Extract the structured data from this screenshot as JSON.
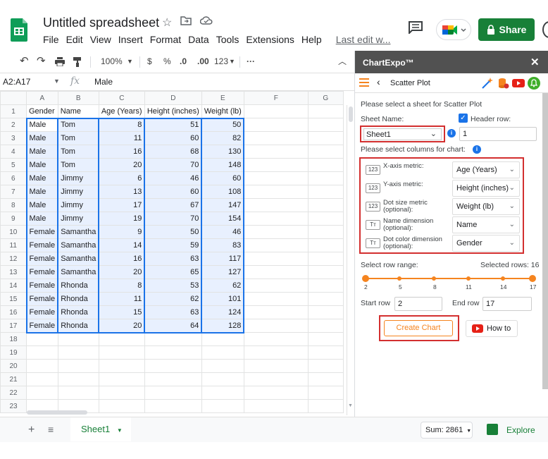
{
  "app": {
    "doc_title": "Untitled spreadsheet",
    "menu": [
      "File",
      "Edit",
      "View",
      "Insert",
      "Format",
      "Data",
      "Tools",
      "Extensions",
      "Help"
    ],
    "last_edit": "Last edit w...",
    "share_label": "Share"
  },
  "toolbar": {
    "zoom": "100%",
    "currency": "$",
    "percent": "%",
    "dec_less": ".0",
    "dec_more": ".00",
    "format": "123"
  },
  "formula_bar": {
    "name_box": "A2:A17",
    "fx": "fx",
    "value": "Male"
  },
  "sheet": {
    "columns": [
      "A",
      "B",
      "C",
      "D",
      "E",
      "F",
      "G"
    ],
    "rows": [
      [
        "Gender",
        "Name",
        "Age (Years)",
        "Height (inches)",
        "Weight (lb)"
      ],
      [
        "Male",
        "Tom",
        "8",
        "51",
        "50"
      ],
      [
        "Male",
        "Tom",
        "11",
        "60",
        "82"
      ],
      [
        "Male",
        "Tom",
        "16",
        "68",
        "130"
      ],
      [
        "Male",
        "Tom",
        "20",
        "70",
        "148"
      ],
      [
        "Male",
        "Jimmy",
        "6",
        "46",
        "60"
      ],
      [
        "Male",
        "Jimmy",
        "13",
        "60",
        "108"
      ],
      [
        "Male",
        "Jimmy",
        "17",
        "67",
        "147"
      ],
      [
        "Male",
        "Jimmy",
        "19",
        "70",
        "154"
      ],
      [
        "Female",
        "Samantha",
        "9",
        "50",
        "46"
      ],
      [
        "Female",
        "Samantha",
        "14",
        "59",
        "83"
      ],
      [
        "Female",
        "Samantha",
        "16",
        "63",
        "117"
      ],
      [
        "Female",
        "Samantha",
        "20",
        "65",
        "127"
      ],
      [
        "Female",
        "Rhonda",
        "8",
        "53",
        "62"
      ],
      [
        "Female",
        "Rhonda",
        "11",
        "62",
        "101"
      ],
      [
        "Female",
        "Rhonda",
        "15",
        "63",
        "124"
      ],
      [
        "Female",
        "Rhonda",
        "20",
        "64",
        "128"
      ],
      [
        "",
        "",
        "",
        "",
        ""
      ],
      [
        "",
        "",
        "",
        "",
        ""
      ],
      [
        "",
        "",
        "",
        "",
        ""
      ],
      [
        "",
        "",
        "",
        "",
        ""
      ],
      [
        "",
        "",
        "",
        "",
        ""
      ],
      [
        "",
        "",
        "",
        "",
        ""
      ]
    ]
  },
  "bottom": {
    "sheet_tab": "Sheet1",
    "sum": "Sum: 2861",
    "explore": "Explore"
  },
  "panel": {
    "title": "ChartExpo™",
    "close": "✕",
    "chart_type": "Scatter Plot",
    "select_sheet_prompt": "Please select a sheet for Scatter Plot",
    "sheet_name_label": "Sheet Name:",
    "sheet_name_value": "Sheet1",
    "header_row_label": "Header row:",
    "header_row_value": "1",
    "select_columns_prompt": "Please select columns for chart:",
    "metrics": [
      {
        "badge": "123",
        "label": "X-axis metric:",
        "value": "Age (Years)"
      },
      {
        "badge": "123",
        "label": "Y-axis metric:",
        "value": "Height (inches)"
      },
      {
        "badge": "123",
        "label": "Dot size metric (optional):",
        "value": "Weight (lb)"
      },
      {
        "badge": "Tт",
        "label": "Name dimension (optional):",
        "value": "Name"
      },
      {
        "badge": "Tт",
        "label": "Dot color dimension (optional):",
        "value": "Gender"
      }
    ],
    "row_range_label": "Select row range:",
    "selected_rows_label": "Selected rows: 16",
    "range_ticks": [
      "2",
      "5",
      "8",
      "11",
      "14",
      "17"
    ],
    "start_row_label": "Start row",
    "start_row_value": "2",
    "end_row_label": "End row",
    "end_row_value": "17",
    "create_chart": "Create Chart",
    "how_to": "How to"
  },
  "colors": {
    "brand_green": "#188038",
    "selection_blue": "#1a73e8",
    "selection_fill": "#e8f0fe",
    "chartexpo_orange": "#f5841f",
    "highlight_red": "#d32f2f",
    "panel_header": "#515151"
  }
}
